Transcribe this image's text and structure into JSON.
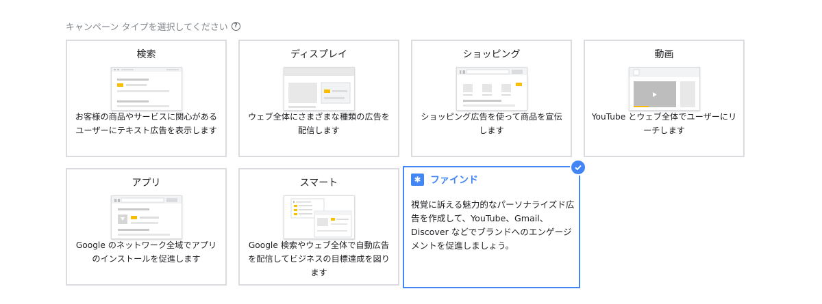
{
  "header": {
    "title": "キャンペーン タイプを選択してください",
    "help_icon": "help-circle-icon"
  },
  "cards": [
    {
      "title": "検索",
      "description": "お客様の商品やサービスに関心があるユーザーにテキスト広告を表示します"
    },
    {
      "title": "ディスプレイ",
      "description": "ウェブ全体にさまざまな種類の広告を配信します"
    },
    {
      "title": "ショッピング",
      "description": "ショッピング広告を使って商品を宣伝します"
    },
    {
      "title": "動画",
      "description": "YouTube とウェブ全体でユーザーにリーチします"
    },
    {
      "title": "アプリ",
      "description": "Google のネットワーク全域でアプリのインストールを促進します"
    },
    {
      "title": "スマート",
      "description": "Google 検索やウェブ全体で自動広告を配信してビジネスの目標達成を図ります"
    },
    {
      "title": "ファインド",
      "description": "視覚に訴える魅力的なパーソナライズド広告を作成して、YouTube、Gmail、Discover などでブランドへのエンゲージメントを促進しましょう。",
      "selected": true,
      "icon": "sparkle-icon"
    }
  ],
  "colors": {
    "accent": "#4285f4",
    "highlight": "#fbbc04",
    "border": "#dadce0"
  }
}
